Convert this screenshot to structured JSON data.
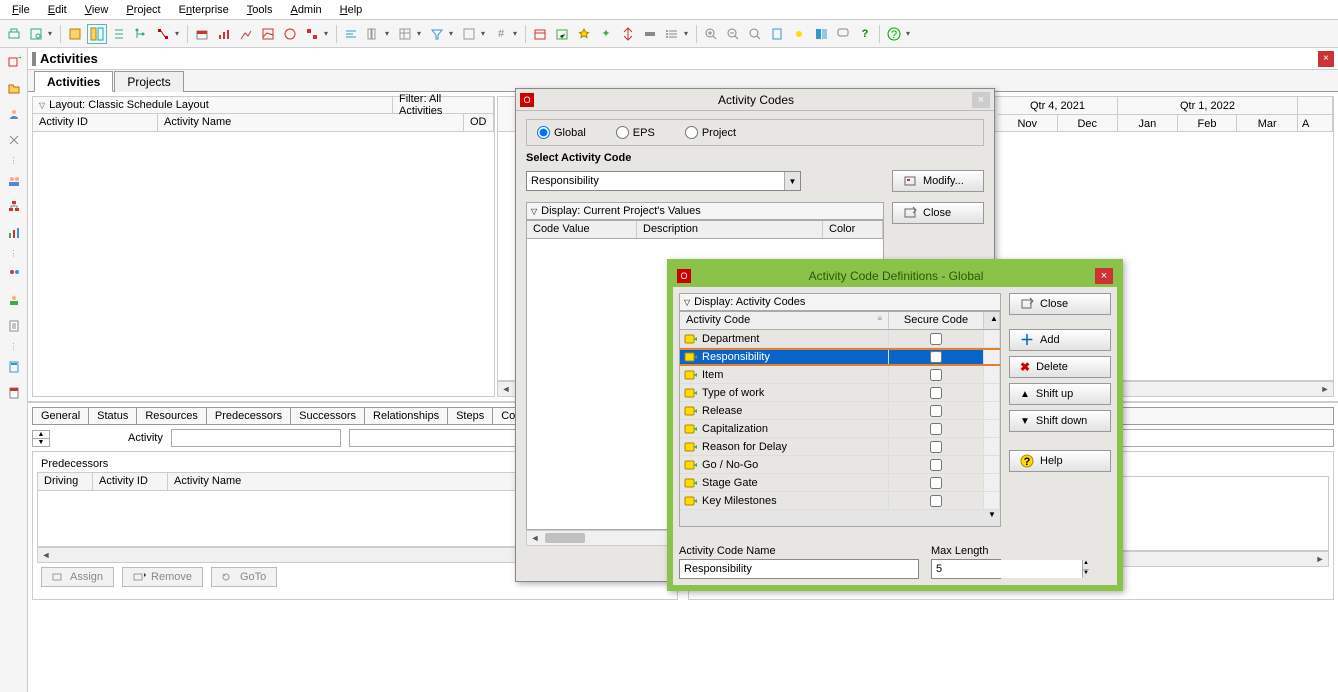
{
  "menu": [
    "File",
    "Edit",
    "View",
    "Project",
    "Enterprise",
    "Tools",
    "Admin",
    "Help"
  ],
  "title": "Activities",
  "tabs": {
    "activities": "Activities",
    "projects": "Projects"
  },
  "layout": {
    "label": "Layout: Classic Schedule Layout",
    "filter": "Filter: All Activities"
  },
  "gridCols": {
    "activityId": "Activity ID",
    "activityName": "Activity Name",
    "od": "OD"
  },
  "timeline": {
    "q4": "Qtr 4, 2021",
    "q1": "Qtr 1, 2022",
    "months": [
      "Nov",
      "Dec",
      "Jan",
      "Feb",
      "Mar",
      "A"
    ]
  },
  "bottomTabs": [
    "General",
    "Status",
    "Resources",
    "Predecessors",
    "Successors",
    "Relationships",
    "Steps",
    "Codes"
  ],
  "activityLabel": "Activity",
  "predecessors": {
    "title": "Predecessors",
    "cols": [
      "Driving",
      "Activity ID",
      "Activity Name"
    ]
  },
  "buttons": {
    "assign": "Assign",
    "remove": "Remove",
    "goto": "GoTo"
  },
  "dlgCodes": {
    "title": "Activity Codes",
    "radios": {
      "global": "Global",
      "eps": "EPS",
      "project": "Project"
    },
    "selectLabel": "Select Activity Code",
    "selected": "Responsibility",
    "modify": "Modify...",
    "display": "Display: Current Project's Values",
    "close": "Close",
    "cols": {
      "codeValue": "Code Value",
      "description": "Description",
      "color": "Color"
    }
  },
  "dlgDefs": {
    "title": "Activity Code Definitions - Global",
    "display": "Display: Activity Codes",
    "cols": {
      "activityCode": "Activity Code",
      "secureCode": "Secure Code"
    },
    "rows": [
      "Department",
      "Responsibility",
      "Item",
      "Type of work",
      "Release",
      "Capitalization",
      "Reason for Delay",
      "Go / No-Go",
      "Stage Gate",
      "Key Milestones"
    ],
    "actions": {
      "close": "Close",
      "add": "Add",
      "delete": "Delete",
      "shiftup": "Shift up",
      "shiftdown": "Shift down",
      "help": "Help"
    },
    "codeNameLabel": "Activity Code Name",
    "codeNameValue": "Responsibility",
    "maxLenLabel": "Max Length",
    "maxLenValue": "5"
  }
}
